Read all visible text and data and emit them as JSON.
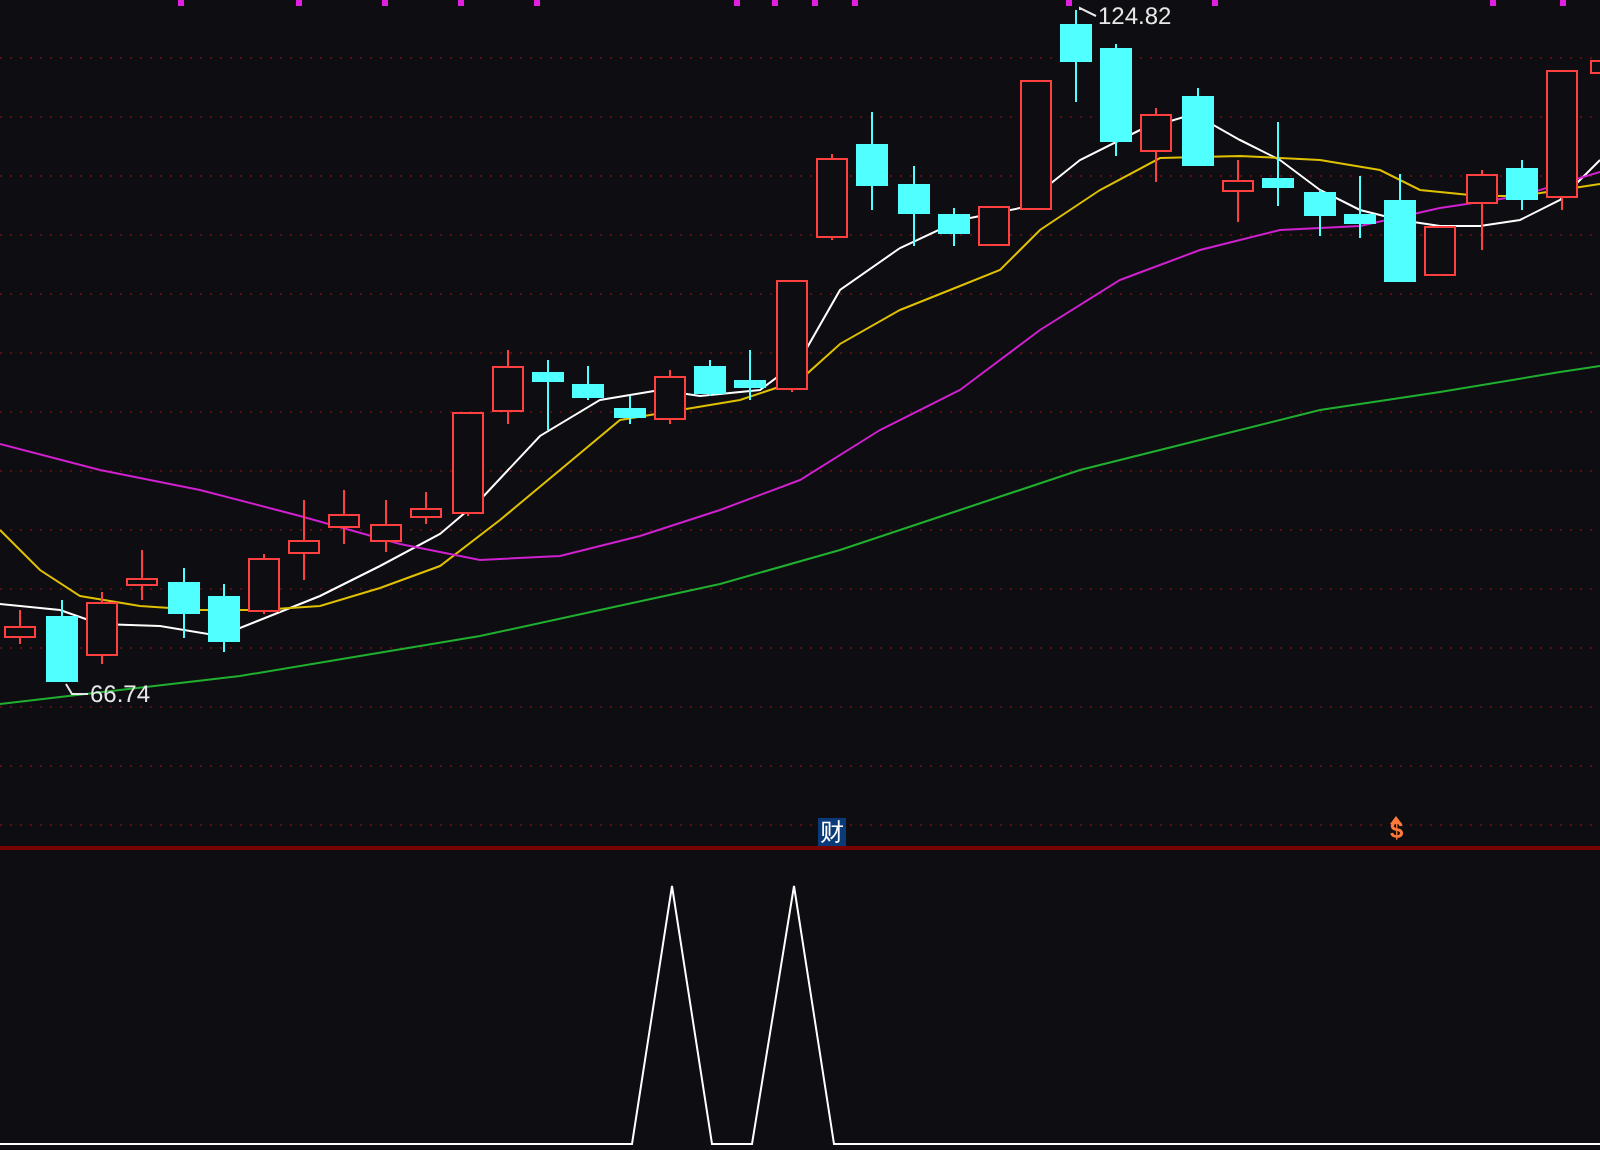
{
  "price_chart": {
    "high_label": {
      "text": "124.82"
    },
    "low_label": {
      "text": "66.74"
    },
    "event_markers": [
      {
        "kind": "finance",
        "text": "财"
      },
      {
        "kind": "dividend",
        "text": "$"
      }
    ]
  }
}
